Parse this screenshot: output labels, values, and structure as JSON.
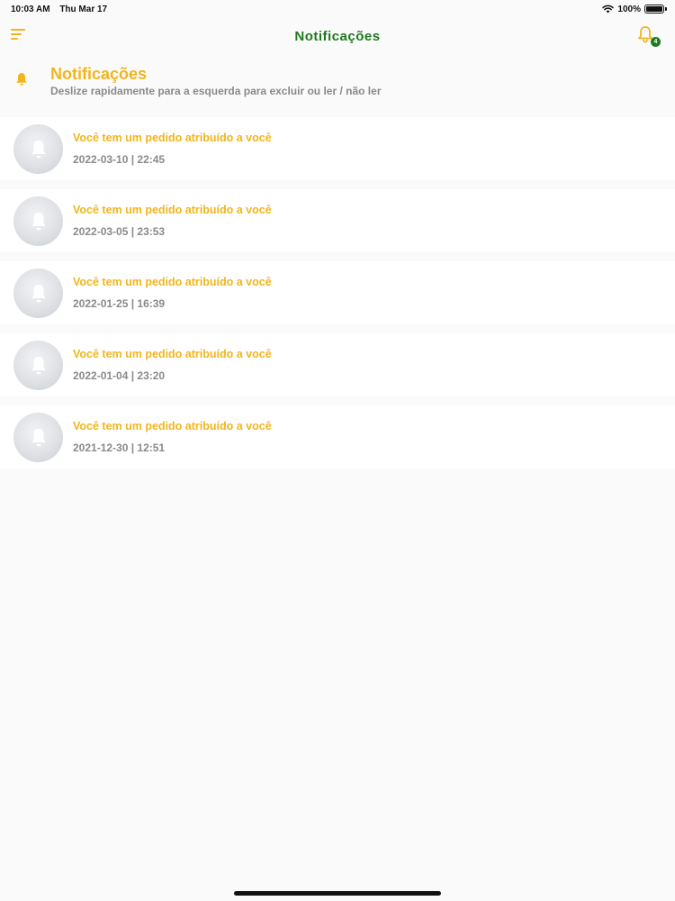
{
  "status_bar": {
    "time": "10:03 AM",
    "date": "Thu Mar 17",
    "battery": "100%"
  },
  "nav": {
    "title": "Notificações",
    "badge_count": "4"
  },
  "header": {
    "title": "Notificações",
    "subtitle": "Deslize rapidamente para a esquerda para excluir ou ler / não ler"
  },
  "notifications": [
    {
      "message": "Você tem um pedido atribuído a você",
      "date": "2022-03-10 | 22:45"
    },
    {
      "message": "Você tem um pedido atribuído a você",
      "date": "2022-03-05 | 23:53"
    },
    {
      "message": "Você tem um pedido atribuído a você",
      "date": "2022-01-25 | 16:39"
    },
    {
      "message": "Você tem um pedido atribuído a você",
      "date": "2022-01-04 | 23:20"
    },
    {
      "message": "Você tem um pedido atribuído a você",
      "date": "2021-12-30 | 12:51"
    }
  ],
  "icons": {
    "menu": "sort-menu-icon",
    "bell": "bell-icon",
    "wifi": "wifi-icon",
    "battery": "battery-icon"
  },
  "colors": {
    "accent_yellow": "#f2b51c",
    "title_green": "#1e7a1e",
    "muted_gray": "#8a8a8a",
    "background": "#fafafa"
  }
}
